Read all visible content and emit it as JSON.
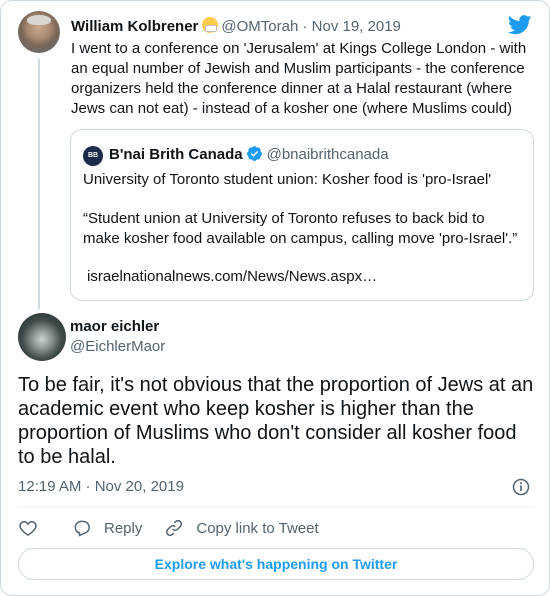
{
  "parent_tweet": {
    "name": "William Kolbrener",
    "handle": "@OMTorah",
    "separator": "·",
    "date": "Nov 19, 2019",
    "text": "I went to a conference on 'Jerusalem' at Kings College London - with an equal number of Jewish and Muslim participants - the conference organizers held the conference dinner at a Halal restaurant (where Jews can not eat) - instead of a kosher one (where Muslims could)"
  },
  "quoted_tweet": {
    "name": "B'nai Brith Canada",
    "handle": "@bnaibrithcanada",
    "line1": "University of Toronto student union: Kosher food is 'pro-Israel'",
    "line2": "“Student union at University of Toronto refuses to back bid to",
    "line3": "make kosher food available on campus, calling move 'pro-Israel'.”",
    "link": "israelnationalnews.com/News/News.aspx…"
  },
  "main_tweet": {
    "name": "maor eichler",
    "handle": "@EichlerMaor",
    "text": "To be fair, it's not obvious that the proportion of Jews at an academic event who keep kosher is higher than the proportion of Muslims who don't consider all kosher food to be halal.",
    "timestamp": "12:19 AM · Nov 20, 2019"
  },
  "actions": {
    "reply_label": "Reply",
    "copy_label": "Copy link to Tweet"
  },
  "explore_label": "Explore what's happening on Twitter",
  "colors": {
    "accent": "#1d9bf0",
    "secondary_text": "#536471",
    "border": "#cfd9de"
  },
  "icons": [
    "twitter-bird-icon",
    "verified-badge-icon",
    "info-icon",
    "heart-icon",
    "reply-icon",
    "link-icon"
  ]
}
